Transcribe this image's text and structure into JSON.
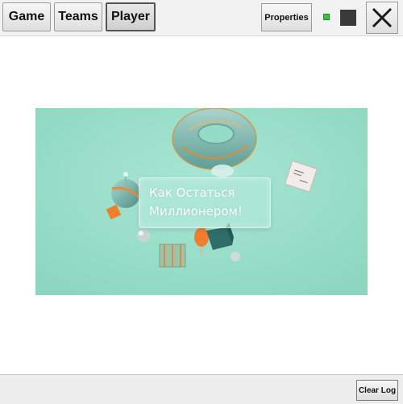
{
  "toolbar": {
    "tabs": [
      {
        "label": "Game"
      },
      {
        "label": "Teams"
      },
      {
        "label": "Player"
      }
    ],
    "properties_label": "Properties",
    "status_color": "#35c53a",
    "stop_icon": "stop-square-icon",
    "close_icon": "close-x-icon"
  },
  "player": {
    "title_line1": "Как Остаться",
    "title_line2": "Миллионером!",
    "background_color": "#95dcc7"
  },
  "footer": {
    "clear_log_label": "Clear Log"
  }
}
